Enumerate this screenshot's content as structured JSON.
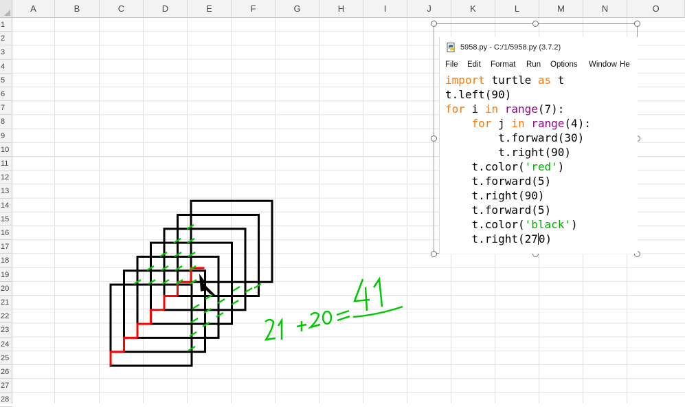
{
  "spreadsheet": {
    "columns": [
      "A",
      "B",
      "C",
      "D",
      "E",
      "F",
      "G",
      "H",
      "I",
      "J",
      "K",
      "L",
      "M",
      "N",
      "O"
    ],
    "rows": [
      "1",
      "2",
      "3",
      "4",
      "5",
      "6",
      "7",
      "8",
      "9",
      "10",
      "11",
      "12",
      "13",
      "14",
      "15",
      "16",
      "17",
      "18",
      "19",
      "20",
      "21",
      "22",
      "23",
      "24",
      "25",
      "26",
      "27",
      "28"
    ]
  },
  "annotation": {
    "handwritten_text": "21 +20 = 41",
    "color": "#00c800"
  },
  "drawing": {
    "square_color": "#000000",
    "step_color": "#ff0000",
    "tick_color": "#00c800"
  },
  "idle_window": {
    "title": "5958.py - C:/1/5958.py (3.7.2)",
    "icon": "python-file-icon",
    "menu": [
      "File",
      "Edit",
      "Format",
      "Run",
      "Options",
      "Window",
      "He"
    ],
    "code_lines": [
      [
        {
          "t": "import",
          "c": "kw"
        },
        {
          "t": " turtle ",
          "c": ""
        },
        {
          "t": "as",
          "c": "kw"
        },
        {
          "t": " t",
          "c": ""
        }
      ],
      [
        {
          "t": "t.left(90)",
          "c": ""
        }
      ],
      [
        {
          "t": "for",
          "c": "kw"
        },
        {
          "t": " i ",
          "c": ""
        },
        {
          "t": "in",
          "c": "kw"
        },
        {
          "t": " ",
          "c": ""
        },
        {
          "t": "range",
          "c": "bi"
        },
        {
          "t": "(7):",
          "c": ""
        }
      ],
      [
        {
          "t": "    ",
          "c": ""
        },
        {
          "t": "for",
          "c": "kw"
        },
        {
          "t": " j ",
          "c": ""
        },
        {
          "t": "in",
          "c": "kw"
        },
        {
          "t": " ",
          "c": ""
        },
        {
          "t": "range",
          "c": "bi"
        },
        {
          "t": "(4):",
          "c": ""
        }
      ],
      [
        {
          "t": "        t.forward(30)",
          "c": ""
        }
      ],
      [
        {
          "t": "        t.right(90)",
          "c": ""
        }
      ],
      [
        {
          "t": "    t.color(",
          "c": ""
        },
        {
          "t": "'red'",
          "c": "str"
        },
        {
          "t": ")",
          "c": ""
        }
      ],
      [
        {
          "t": "    t.forward(5)",
          "c": ""
        }
      ],
      [
        {
          "t": "    t.right(90)",
          "c": ""
        }
      ],
      [
        {
          "t": "    t.forward(5)",
          "c": ""
        }
      ],
      [
        {
          "t": "    t.color(",
          "c": ""
        },
        {
          "t": "'black'",
          "c": "str"
        },
        {
          "t": ")",
          "c": ""
        }
      ],
      [
        {
          "t": "    t.right(27",
          "c": ""
        },
        {
          "t": "|",
          "c": "cursor"
        },
        {
          "t": "0)",
          "c": ""
        }
      ]
    ]
  }
}
